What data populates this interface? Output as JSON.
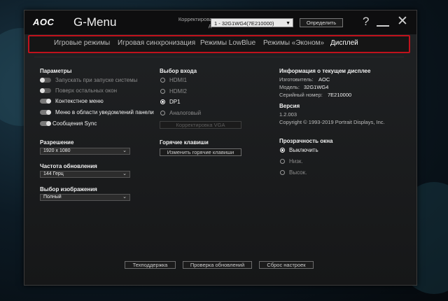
{
  "window": {
    "logo": "AOC",
    "title": "G-Menu",
    "monitor_label": "Корректировать этот дисплей",
    "monitor_value": "1 - 32G1WG4(7E210000)",
    "detect_label": "Определить",
    "help_glyph": "?",
    "close_glyph": "✕"
  },
  "tabs": [
    {
      "label": "Игровые режимы"
    },
    {
      "label": "Игровая синхронизация"
    },
    {
      "label": "Режимы LowBlue"
    },
    {
      "label": "Режимы «Эконом»"
    },
    {
      "label": "Дисплей",
      "active": true
    }
  ],
  "params": {
    "title": "Параметры",
    "items": [
      {
        "label": "Запускать при запуске системы",
        "state": "off"
      },
      {
        "label": "Поверх остальных окон",
        "state": "off"
      },
      {
        "label": "Контекстное меню",
        "state": "on"
      },
      {
        "label": "Меню в области уведомлений панели",
        "state": "on"
      },
      {
        "label": "Сообщения Sync",
        "state": "on"
      }
    ]
  },
  "resolution": {
    "title": "Разрешение",
    "value": "1920 x 1080"
  },
  "refresh": {
    "title": "Частота обновления",
    "value": "144 Герц"
  },
  "image": {
    "title": "Выбор изображения",
    "value": "Полный"
  },
  "input": {
    "title": "Выбор входа",
    "options": [
      {
        "label": "HDMI1",
        "selected": false
      },
      {
        "label": "HDMI2",
        "selected": false
      },
      {
        "label": "DP1",
        "selected": true
      },
      {
        "label": "Аналоговый",
        "selected": false
      }
    ],
    "vga_button": "Корректировка VGA"
  },
  "hotkeys": {
    "title": "Горячие клавиши",
    "button": "Изменить горячие клавиши"
  },
  "info": {
    "title": "Информация о текущем дисплее",
    "manufacturer_label": "Изготовитель:",
    "manufacturer_value": "AOC",
    "model_label": "Модель:",
    "model_value": "32G1WG4",
    "serial_label": "Серийный номер:",
    "serial_value": "7E210000"
  },
  "version": {
    "title": "Версия",
    "number": "1.2.003",
    "copyright": "Copyright © 1993-2019 Portrait Displays, Inc."
  },
  "transparency": {
    "title": "Прозрачность окна",
    "options": [
      {
        "label": "Выключить",
        "selected": true
      },
      {
        "label": "Низк.",
        "selected": false
      },
      {
        "label": "Высок.",
        "selected": false
      }
    ]
  },
  "footer": {
    "support": "Техподдержка",
    "updates": "Проверка обновлений",
    "reset": "Сброс настроек"
  }
}
